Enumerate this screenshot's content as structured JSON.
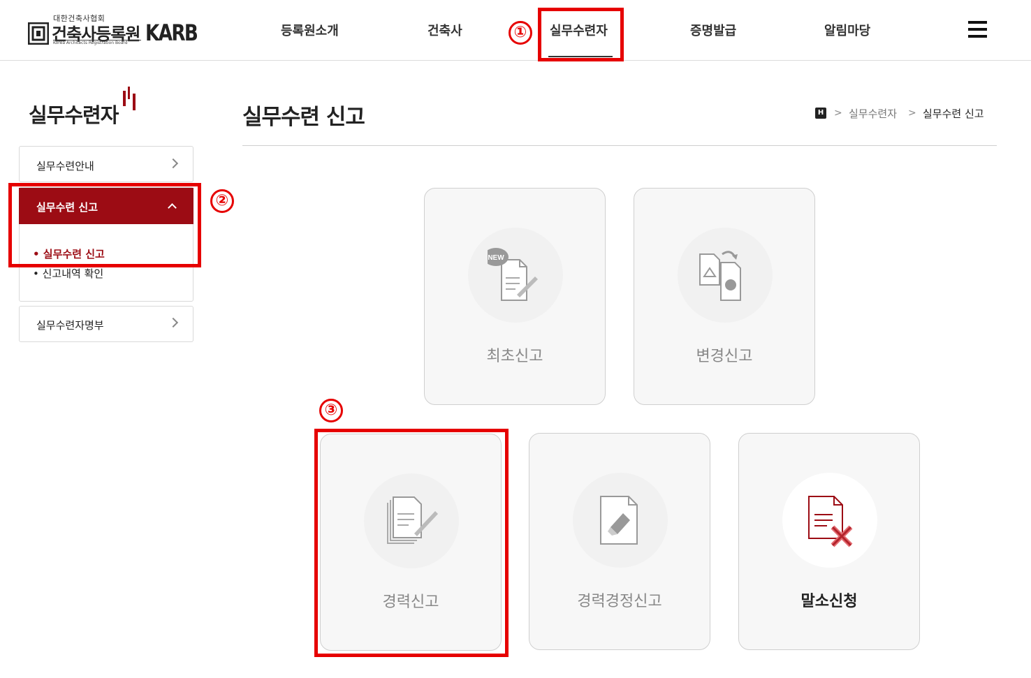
{
  "header": {
    "logo": {
      "sub_text": "대한건축사협회",
      "main_text": "건축사등록원",
      "eng_text": "Korea Architects Registration Board",
      "brand": "KARB"
    },
    "nav": [
      {
        "label": "등록원소개"
      },
      {
        "label": "건축사"
      },
      {
        "label": "실무수련자",
        "active": true
      },
      {
        "label": "증명발급"
      },
      {
        "label": "알림마당"
      }
    ],
    "menu_icon": "hamburger-icon"
  },
  "sidebar": {
    "title": "실무수련자",
    "items": [
      {
        "label": "실무수련안내"
      },
      {
        "label": "실무수련 신고",
        "active": true,
        "sub": [
          {
            "label": "• 실무수련 신고",
            "active": true
          },
          {
            "label": "• 신고내역 확인"
          }
        ]
      },
      {
        "label": "실무수련자명부"
      }
    ]
  },
  "main": {
    "title": "실무수련 신고",
    "breadcrumb": {
      "home": "H",
      "items": [
        "실무수련자",
        "실무수련 신고"
      ]
    },
    "cards": [
      {
        "label": "최초신고",
        "icon": "new-document-icon"
      },
      {
        "label": "변경신고",
        "icon": "change-document-icon"
      },
      {
        "label": "경력신고",
        "icon": "career-document-icon"
      },
      {
        "label": "경력경정신고",
        "icon": "edit-document-icon"
      },
      {
        "label": "말소신청",
        "icon": "cancel-document-icon",
        "emphasis": true
      }
    ]
  },
  "annotations": [
    "①",
    "②",
    "③"
  ],
  "colors": {
    "accent": "#9c0c14",
    "annotation": "#e60000"
  }
}
